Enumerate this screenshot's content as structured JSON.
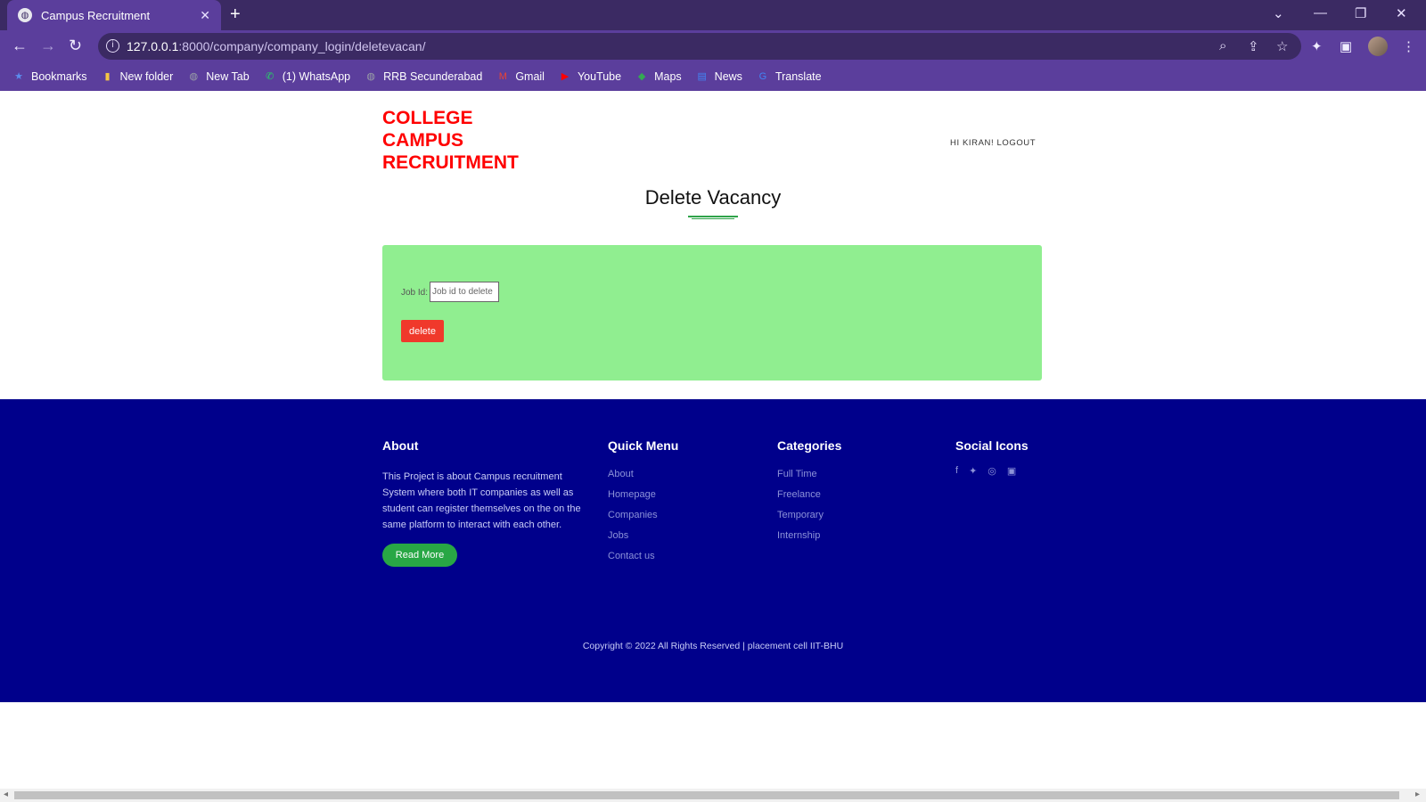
{
  "browser": {
    "tab_title": "Campus Recruitment",
    "tab_close": "✕",
    "new_tab": "+",
    "url_host": "127.0.0.1",
    "url_rest": ":8000/company/company_login/deletevacan/",
    "window_controls": [
      "⌄",
      "—",
      "❐",
      "✕"
    ]
  },
  "bookmarks": [
    {
      "label": "Bookmarks",
      "icon": "star-icon",
      "glyph": "★",
      "color": "#5b8def"
    },
    {
      "label": "New folder",
      "icon": "folder-icon",
      "glyph": "▮",
      "color": "#f5c542"
    },
    {
      "label": "New Tab",
      "icon": "globe-icon",
      "glyph": "◍",
      "color": "#9aa0a6"
    },
    {
      "label": "(1) WhatsApp",
      "icon": "whatsapp-icon",
      "glyph": "✆",
      "color": "#25d366"
    },
    {
      "label": "RRB Secunderabad",
      "icon": "globe-icon",
      "glyph": "◍",
      "color": "#9aa0a6"
    },
    {
      "label": "Gmail",
      "icon": "gmail-icon",
      "glyph": "M",
      "color": "#ea4335"
    },
    {
      "label": "YouTube",
      "icon": "youtube-icon",
      "glyph": "▶",
      "color": "#ff0000"
    },
    {
      "label": "Maps",
      "icon": "maps-icon",
      "glyph": "◆",
      "color": "#34a853"
    },
    {
      "label": "News",
      "icon": "news-icon",
      "glyph": "▤",
      "color": "#4285f4"
    },
    {
      "label": "Translate",
      "icon": "translate-icon",
      "glyph": "G",
      "color": "#4285f4"
    }
  ],
  "header": {
    "brand_line1": "COLLEGE",
    "brand_line2": "CAMPUS",
    "brand_line3": "RECRUITMENT",
    "greeting": "HI KIRAN! LOGOUT"
  },
  "main": {
    "title": "Delete Vacancy",
    "job_id_label": "Job Id:",
    "job_id_placeholder": "Job id to delete",
    "delete_label": "delete"
  },
  "footer": {
    "about": {
      "heading": "About",
      "text": "This Project is about Campus recruitment System where both IT companies as well as student can register themselves on the on the same platform to interact with each other.",
      "button": "Read More"
    },
    "quick_menu": {
      "heading": "Quick Menu",
      "links": [
        "About",
        "Homepage",
        "Companies",
        "Jobs",
        "Contact us"
      ]
    },
    "categories": {
      "heading": "Categories",
      "links": [
        "Full Time",
        "Freelance",
        "Temporary",
        "Internship"
      ]
    },
    "social": {
      "heading": "Social Icons",
      "icons": [
        {
          "name": "facebook-icon",
          "glyph": "f"
        },
        {
          "name": "twitter-icon",
          "glyph": "🐦"
        },
        {
          "name": "instagram-icon",
          "glyph": "◎"
        },
        {
          "name": "youtube-icon",
          "glyph": "▣"
        }
      ]
    },
    "copyright": "Copyright © 2022 All Rights Reserved | placement cell IIT-BHU"
  },
  "colors": {
    "brand": "#ff0000",
    "form_bg": "#90ee90",
    "delete_button": "#f0392b",
    "footer_bg": "#00008b",
    "read_more": "#28a745"
  }
}
